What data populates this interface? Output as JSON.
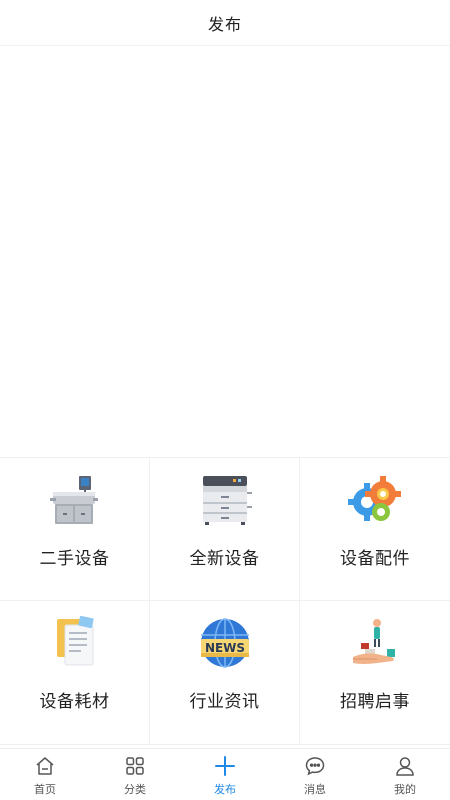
{
  "header": {
    "title": "发布"
  },
  "categories": [
    {
      "label": "二手设备",
      "icon": "used-equipment-icon"
    },
    {
      "label": "全新设备",
      "icon": "new-equipment-icon"
    },
    {
      "label": "设备配件",
      "icon": "gears-icon"
    },
    {
      "label": "设备耗材",
      "icon": "documents-icon"
    },
    {
      "label": "行业资讯",
      "icon": "news-globe-icon"
    },
    {
      "label": "招聘启事",
      "icon": "hand-figure-icon"
    }
  ],
  "tabbar": {
    "active_index": 2,
    "accent": "#1e88e5",
    "items": [
      {
        "label": "首页",
        "icon": "home-icon"
      },
      {
        "label": "分类",
        "icon": "grid-icon"
      },
      {
        "label": "发布",
        "icon": "plus-icon"
      },
      {
        "label": "消息",
        "icon": "chat-icon"
      },
      {
        "label": "我的",
        "icon": "user-icon"
      }
    ]
  }
}
